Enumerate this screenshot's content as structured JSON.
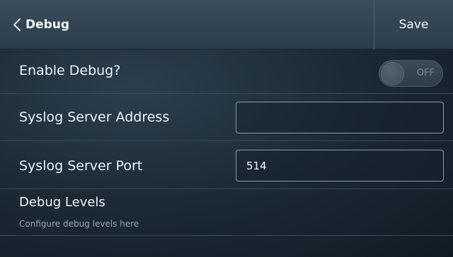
{
  "header": {
    "title": "Debug",
    "save_label": "Save",
    "back_icon": "chevron-left-icon"
  },
  "settings": {
    "enable_debug": {
      "label": "Enable Debug?",
      "toggle_state": "OFF",
      "enabled": false
    },
    "syslog_address": {
      "label": "Syslog Server Address",
      "value": ""
    },
    "syslog_port": {
      "label": "Syslog Server Port",
      "value": "514"
    },
    "debug_levels": {
      "label": "Debug Levels",
      "description": "Configure debug levels here"
    }
  },
  "colors": {
    "header_bg": "#33475a",
    "body_bg": "#1c2b37",
    "divider": "#3a4a57",
    "field_border": "#8a99a6"
  }
}
